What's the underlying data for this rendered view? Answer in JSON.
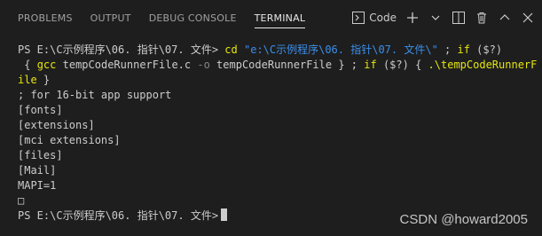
{
  "panel": {
    "tabs": [
      "PROBLEMS",
      "OUTPUT",
      "DEBUG CONSOLE",
      "TERMINAL"
    ],
    "active_tab": "TERMINAL"
  },
  "toolbar": {
    "shell_label": "Code",
    "icons": [
      "terminal-icon",
      "plus-icon",
      "chevron-down-icon",
      "split-icon",
      "trash-icon",
      "chevron-up-icon",
      "close-icon"
    ]
  },
  "terminal": {
    "prompt": "PS E:\\C示例程序\\06. 指针\\07. 文件>",
    "cmd": {
      "cd": "cd",
      "cd_arg": "\"e:\\C示例程序\\06. 指针\\07. 文件\\\"",
      "sep1": " ; ",
      "if1": "if",
      "cond1": "($?)",
      "brace_open1": "{",
      "gcc": "gcc",
      "gcc_args_a": "tempCodeRunnerFile.c",
      "flag": "-o",
      "gcc_args_b": "tempCodeRunnerFile",
      "brace_close1": "}",
      "sep2": " ; ",
      "if2": "if",
      "cond2": "($?)",
      "brace_open2": "{",
      "run_a": ".\\tempCodeRunnerF",
      "run_b": "ile",
      "brace_close2": "}"
    },
    "output": [
      "; for 16-bit app support",
      "[fonts]",
      "[extensions]",
      "[mci extensions]",
      "[files]",
      "[Mail]",
      "MAPI=1",
      "□"
    ],
    "final_prompt": "PS E:\\C示例程序\\06. 指针\\07. 文件>"
  },
  "watermark": "CSDN @howard2005"
}
